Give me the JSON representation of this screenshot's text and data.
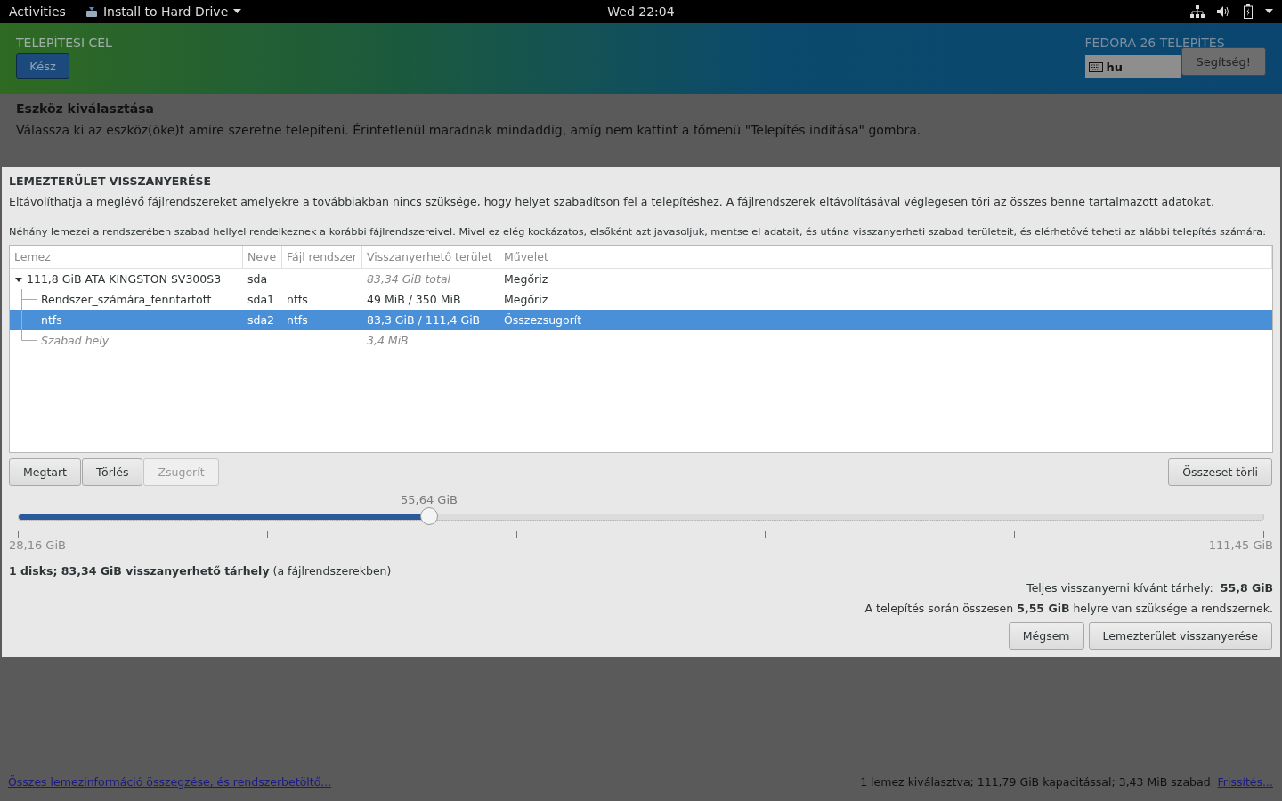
{
  "top_bar": {
    "activities": "Activities",
    "app_menu": "Install to Hard Drive",
    "clock": "Wed 22:04"
  },
  "header": {
    "title": "TELEPÍTÉSI CÉL",
    "done_button": "Kész",
    "product": "FEDORA 26 TELEPÍTÉS",
    "keyboard_layout": "hu",
    "help_button": "Segítség!"
  },
  "page": {
    "heading": "Eszköz kiválasztása",
    "description": "Válassza ki az eszköz(öke)t amire szeretne telepíteni. Érintetlenül maradnak mindaddig, amíg nem kattint a főmenü \"Telepítés indítása\" gombra."
  },
  "dialog": {
    "title": "LEMEZTERÜLET VISSZANYERÉSE",
    "text_1": "Eltávolíthatja a meglévő fájlrendszereket amelyekre a továbbiakban nincs szüksége, hogy helyet szabadítson fel a telepítéshez. A fájlrendszerek eltávolításával véglegesen töri az összes benne tartalmazott adatokat.",
    "text_2": "Néhány lemezei a rendszerében szabad hellyel rendelkeznek a korábbi fájlrendszereivel. Mivel ez elég kockázatos, elsőként azt javasoljuk, mentse el adatait, és utána visszanyerheti szabad területeit, és elérhetővé teheti az alábbi telepítés számára:",
    "table": {
      "columns": [
        "Lemez",
        "Neve",
        "Fájl rendszer",
        "Visszanyerhető terület",
        "Művelet"
      ],
      "rows": [
        {
          "kind": "disk",
          "name": "111,8 GiB ATA KINGSTON SV300S3",
          "device": "sda",
          "reclaimable": "83,34 GiB total",
          "action": "Megőriz",
          "expanded": true,
          "selected": false,
          "children": [
            {
              "kind": "partition",
              "name": "Rendszer_számára_fenntartott",
              "device": "sda1",
              "filesystem": "ntfs",
              "reclaimable": "49 MiB / 350 MiB",
              "action": "Megőriz",
              "selected": false
            },
            {
              "kind": "partition",
              "name": "ntfs",
              "device": "sda2",
              "filesystem": "ntfs",
              "reclaimable": "83,3 GiB / 111,4 GiB",
              "action": "Összezsugorít",
              "selected": true
            },
            {
              "kind": "free",
              "name": "Szabad hely",
              "reclaimable": "3,4 MiB",
              "selected": false
            }
          ]
        }
      ]
    },
    "buttons": [
      {
        "label": "Megtart",
        "disabled": false
      },
      {
        "label": "Törlés",
        "disabled": false
      },
      {
        "label": "Zsugorít",
        "disabled": true
      }
    ],
    "delete_all_button": "Összeset törli",
    "slider": {
      "value": "55,64 GiB",
      "level": 0.33,
      "min": "28,16 GiB",
      "max": "111,45 GiB"
    },
    "summary": "**1 disks; 83,34 GiB visszanyerhető tárhely** (a fájlrendszerekben)",
    "total_label": "Teljes visszanyerni kívánt tárhely:",
    "total_value": "55,8 GiB",
    "required": "A telepítés során összesen **5,55 GiB** helyre van szüksége a rendszernek.",
    "cancel_button": "Mégsem",
    "reclaim_button": "Lemezterület visszanyerése"
  },
  "footer": {
    "link": "Összes lemezinformáció összegzése, és rendszerbetöltő...",
    "status": "1 lemez kiválasztva; 111,79 GiB kapacitással; 3,43 MiB szabad",
    "refresh_link": "Frissítés..."
  }
}
